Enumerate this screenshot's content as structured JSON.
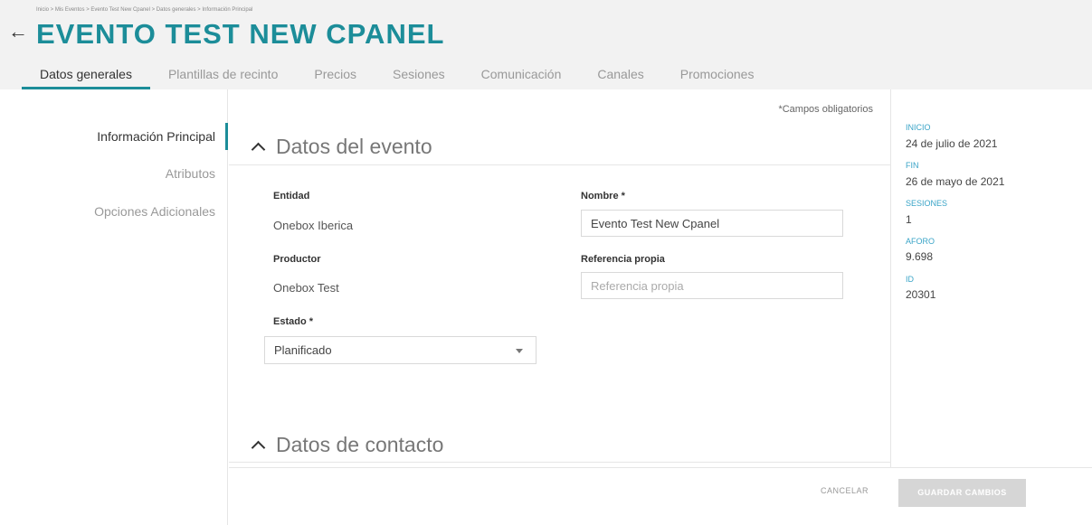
{
  "header": {
    "breadcrumb": "Inicio > Mis Eventos > Evento Test New Cpanel > Datos generales > Información Principal",
    "title": "EVENTO TEST NEW CPANEL",
    "back_icon": "arrow-left-icon"
  },
  "tabs": [
    {
      "label": "Datos generales",
      "active": true
    },
    {
      "label": "Plantillas de recinto"
    },
    {
      "label": "Precios"
    },
    {
      "label": "Sesiones"
    },
    {
      "label": "Comunicación"
    },
    {
      "label": "Canales"
    },
    {
      "label": "Promociones"
    }
  ],
  "left_nav": [
    {
      "label": "Información Principal",
      "active": true
    },
    {
      "label": "Atributos"
    },
    {
      "label": "Opciones Adicionales"
    }
  ],
  "form": {
    "required_note": "*Campos obligatorios",
    "section_event": "Datos del evento",
    "entidad_label": "Entidad",
    "entidad_value": "Onebox Iberica",
    "nombre_label": "Nombre *",
    "nombre_value": "Evento Test New Cpanel",
    "productor_label": "Productor",
    "productor_value": "Onebox Test",
    "referencia_label": "Referencia propia",
    "referencia_placeholder": "Referencia propia",
    "estado_label": "Estado *",
    "estado_value": "Planificado",
    "section_contact": "Datos de contacto"
  },
  "summary": {
    "inicio_label": "INICIO",
    "inicio_value": "24 de julio de 2021",
    "fin_label": "FIN",
    "fin_value": "26 de mayo de 2021",
    "sesiones_label": "SESIONES",
    "sesiones_value": "1",
    "aforo_label": "AFORO",
    "aforo_value": "9.698",
    "id_label": "ID",
    "id_value": "20301"
  },
  "footer": {
    "cancel_label": "CANCELAR",
    "save_label": "GUARDAR CAMBIOS"
  },
  "colors": {
    "accent": "#1c8d99",
    "info_label": "#3aa4c7",
    "header_bg": "#f2f2f2"
  }
}
